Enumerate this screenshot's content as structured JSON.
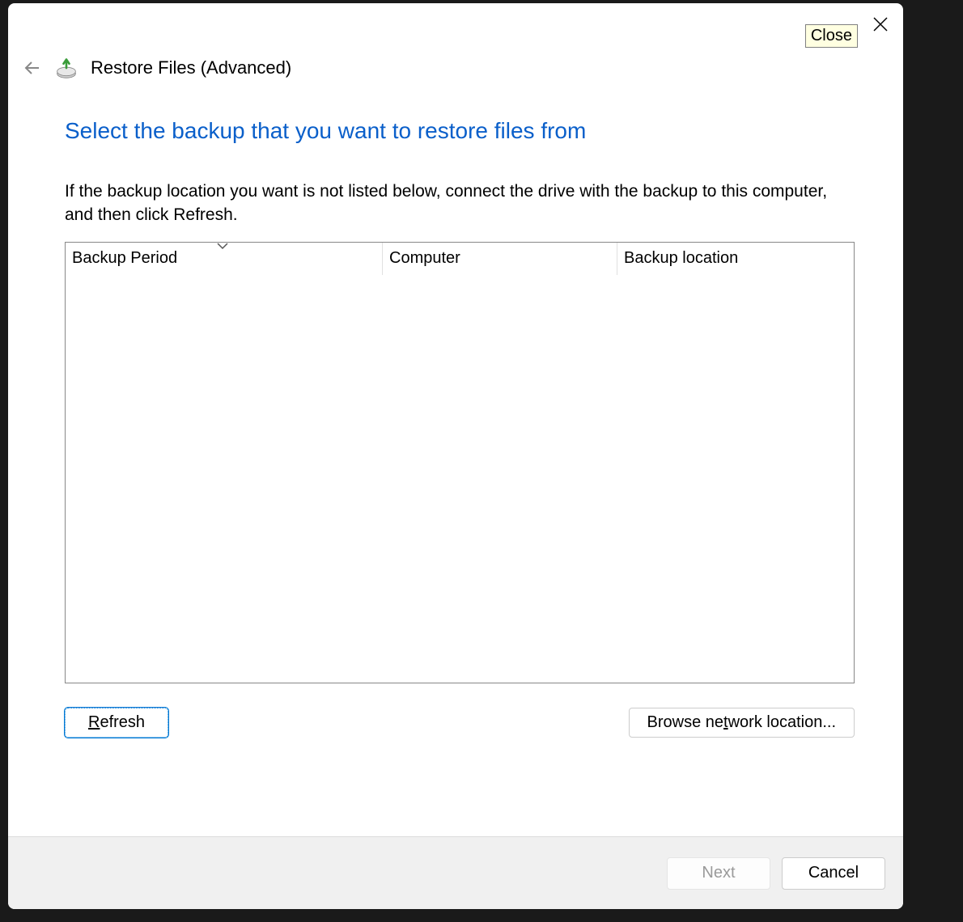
{
  "window": {
    "title": "Restore Files (Advanced)",
    "close_tooltip": "Close"
  },
  "page": {
    "heading": "Select the backup that you want to restore files from",
    "description": "If the backup location you want is not listed below, connect the drive with the backup to this computer, and then click Refresh."
  },
  "columns": {
    "period": "Backup Period",
    "computer": "Computer",
    "location": "Backup location"
  },
  "buttons": {
    "refresh_pre": "",
    "refresh_key": "R",
    "refresh_post": "efresh",
    "browse_pre": "Browse ne",
    "browse_key": "t",
    "browse_post": "work location...",
    "next_pre": "",
    "next_key": "N",
    "next_post": "ext",
    "cancel": "Cancel"
  }
}
